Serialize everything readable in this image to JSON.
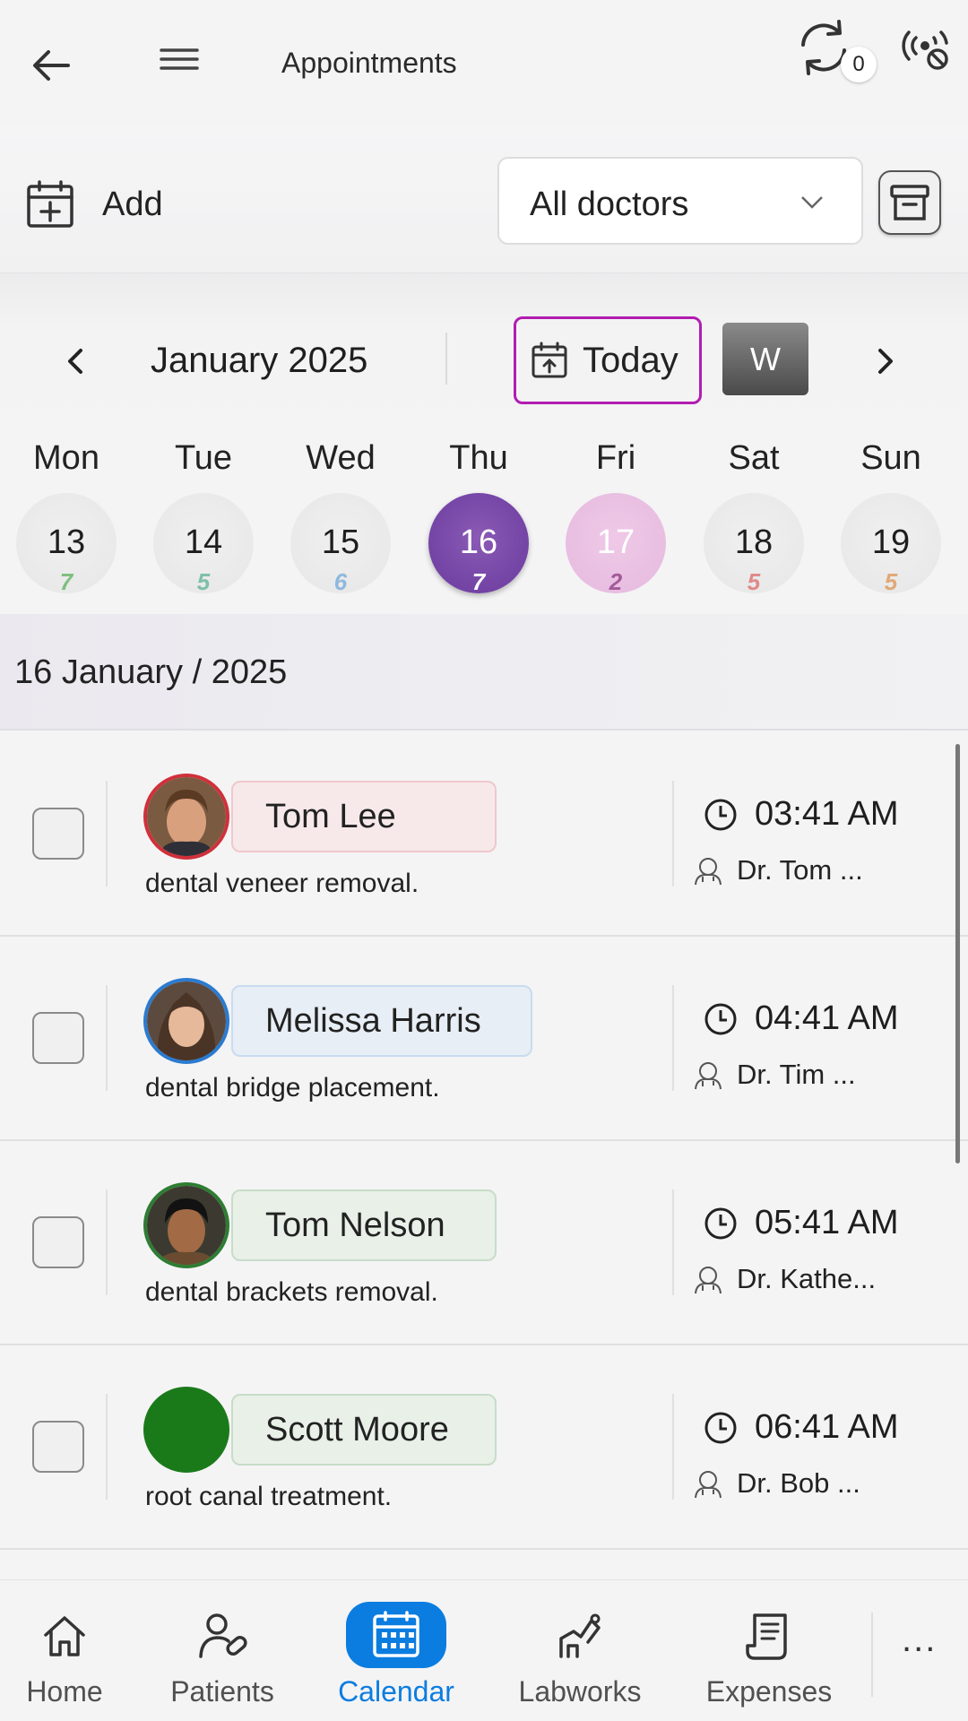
{
  "header": {
    "title": "Appointments",
    "sync_count": "0"
  },
  "toolbar": {
    "add_label": "Add",
    "doctor_filter": "All doctors"
  },
  "calendar": {
    "month_label": "January 2025",
    "today_label": "Today",
    "view_mode": "W",
    "days": [
      {
        "name": "Mon",
        "date": "13",
        "count": "7",
        "count_color": "#7fbf7f"
      },
      {
        "name": "Tue",
        "date": "14",
        "count": "5",
        "count_color": "#7fbfa8"
      },
      {
        "name": "Wed",
        "date": "15",
        "count": "6",
        "count_color": "#8fb8dd"
      },
      {
        "name": "Thu",
        "date": "16",
        "count": "7",
        "count_color": "#ffffff"
      },
      {
        "name": "Fri",
        "date": "17",
        "count": "2",
        "count_color": "#a25a9a"
      },
      {
        "name": "Sat",
        "date": "18",
        "count": "5",
        "count_color": "#e08a8a"
      },
      {
        "name": "Sun",
        "date": "19",
        "count": "5",
        "count_color": "#e0a878"
      }
    ],
    "selected_date": "16 January / 2025"
  },
  "appointments": [
    {
      "patient": "Tom Lee",
      "procedure": "dental veneer removal.",
      "time": "03:41 AM",
      "doctor": "Dr. Tom ...",
      "ring": "#d0303a",
      "pill_bg": "#f7e9ea",
      "pill_border": "#f0c8cc",
      "avatar": "photo-male-1"
    },
    {
      "patient": "Melissa Harris",
      "procedure": "dental bridge placement.",
      "time": "04:41 AM",
      "doctor": "Dr. Tim ...",
      "ring": "#2b7bd0",
      "pill_bg": "#e8eef6",
      "pill_border": "#c9dbef",
      "avatar": "photo-female-1"
    },
    {
      "patient": "Tom Nelson",
      "procedure": "dental brackets removal.",
      "time": "05:41 AM",
      "doctor": "Dr. Kathe...",
      "ring": "#2e7d32",
      "pill_bg": "#e8f0e8",
      "pill_border": "#c8dcc8",
      "avatar": "photo-male-2"
    },
    {
      "patient": "Scott Moore",
      "procedure": "root canal treatment.",
      "time": "06:41 AM",
      "doctor": "Dr. Bob ...",
      "ring": "#1a7a1a",
      "pill_bg": "#e8f0e8",
      "pill_border": "#c8dcc8",
      "avatar": "solid-green"
    }
  ],
  "nav": {
    "items": [
      {
        "label": "Home",
        "icon": "home-icon"
      },
      {
        "label": "Patients",
        "icon": "patients-icon"
      },
      {
        "label": "Calendar",
        "icon": "calendar-icon"
      },
      {
        "label": "Labworks",
        "icon": "labworks-icon"
      },
      {
        "label": "Expenses",
        "icon": "expenses-icon"
      }
    ],
    "more_label": "..."
  }
}
